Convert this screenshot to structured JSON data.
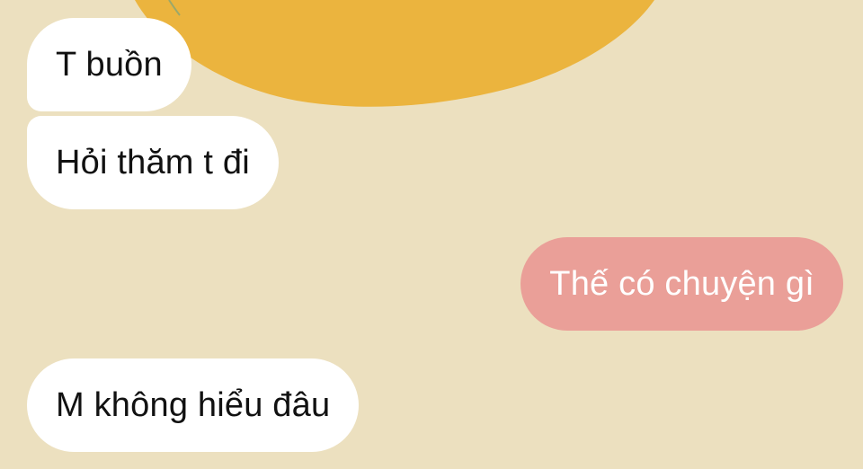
{
  "theme": {
    "background_color": "#ece0bf",
    "decoration_color": "#ebb43e",
    "incoming_bubble_color": "#ffffff",
    "outgoing_bubble_color": "#ea9f98"
  },
  "messages": [
    {
      "direction": "incoming",
      "text": "T buồn"
    },
    {
      "direction": "incoming",
      "text": "Hỏi thăm t đi"
    },
    {
      "direction": "outgoing",
      "text": "Thế có chuyện gì"
    },
    {
      "direction": "incoming",
      "text": "M không hiểu đâu"
    }
  ]
}
